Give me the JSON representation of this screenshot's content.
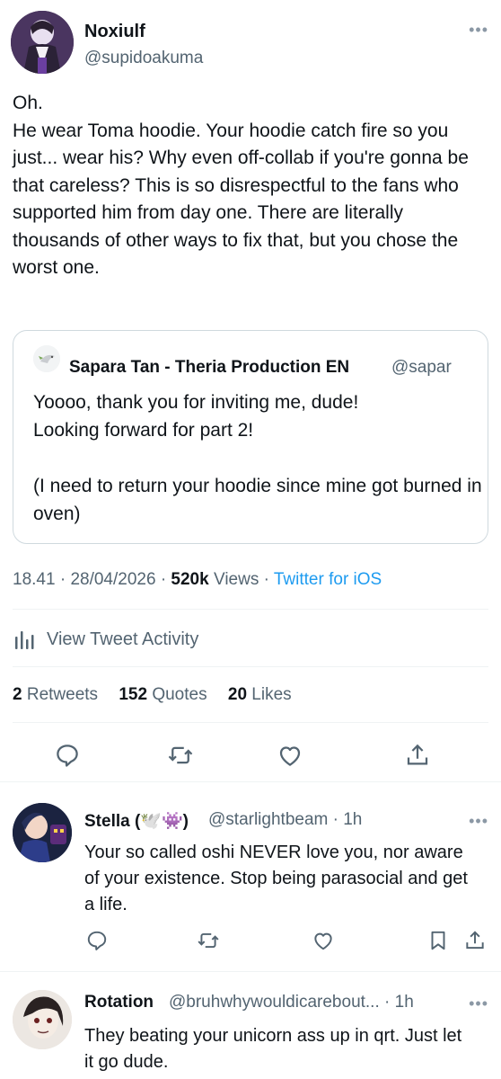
{
  "main_tweet": {
    "author_name": "Noxiulf",
    "author_handle": "@supidoakuma",
    "text": "Oh.\nHe wear Toma hoodie. Your hoodie catch fire so you just... wear his? Why even off-collab if you're gonna be that careless? This is so disrespectful to the fans who supported him from day one. There are literally thousands of other ways to fix that, but you chose the worst one.",
    "more_label": "•••"
  },
  "quoted_tweet": {
    "author_name": "Sapara Tan - Theria Production EN",
    "author_handle": "@sapar",
    "text": "Yoooo, thank you for inviting me, dude!\nLooking forward for part 2!\n\n(I need to return your hoodie since mine got burned in oven)"
  },
  "meta": {
    "time": "18.41",
    "date": "28/04/2026",
    "views_count": "520k",
    "views_label": "Views",
    "source": "Twitter for iOS"
  },
  "activity_label": "View Tweet Activity",
  "stats": {
    "retweets_count": "2",
    "retweets_label": "Retweets",
    "quotes_count": "152",
    "quotes_label": "Quotes",
    "likes_count": "20",
    "likes_label": "Likes"
  },
  "replies": [
    {
      "author_name": "Stella (🕊️👾)",
      "author_handle": "@starlightbeam",
      "time": "1h",
      "text": "Your so called oshi NEVER love you, nor aware of your existence. Stop being parasocial and get a life."
    },
    {
      "author_name": "Rotation",
      "author_handle": "@bruhwhywouldicarebout...",
      "time": "1h",
      "text": "They beating your unicorn ass up in qrt. Just let it go dude."
    }
  ],
  "colors": {
    "text": "#0f1419",
    "secondary": "#536471",
    "link": "#1d9bf0",
    "border": "#cfd9de",
    "divider": "#eff3f4"
  },
  "icons": [
    "reply-icon",
    "retweet-icon",
    "like-icon",
    "share-icon",
    "bookmark-icon",
    "activity-chart-icon",
    "more-icon"
  ]
}
